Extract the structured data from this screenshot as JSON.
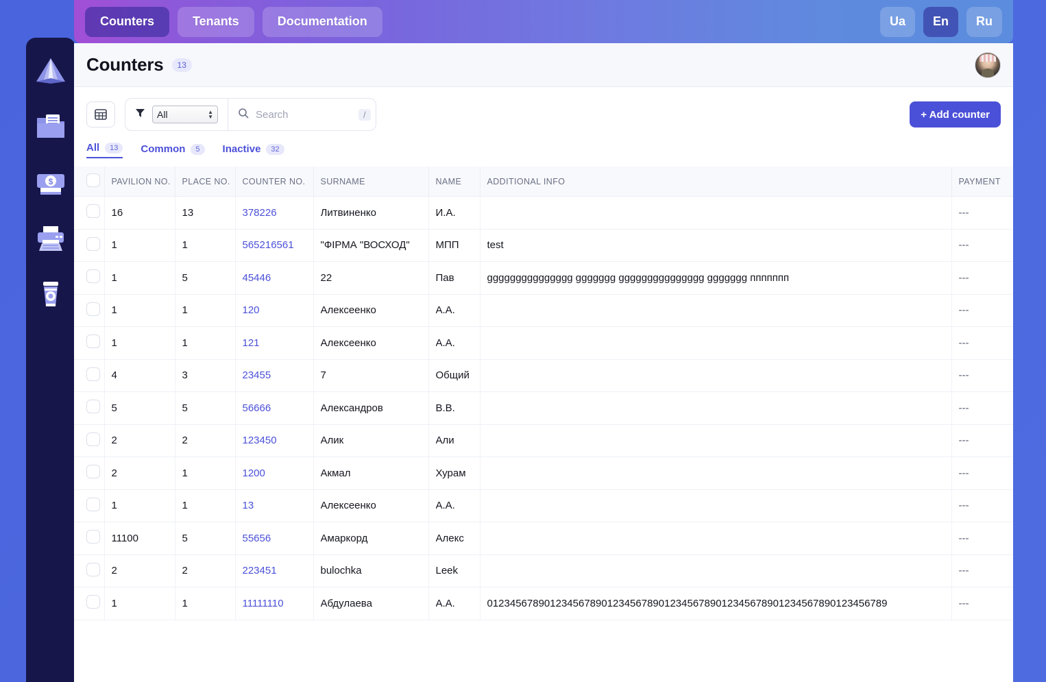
{
  "topnav": {
    "items": [
      {
        "label": "Counters",
        "active": true
      },
      {
        "label": "Tenants",
        "active": false
      },
      {
        "label": "Documentation",
        "active": false
      }
    ],
    "languages": [
      {
        "label": "Ua",
        "active": false
      },
      {
        "label": "En",
        "active": true
      },
      {
        "label": "Ru",
        "active": false
      }
    ]
  },
  "sidebar": {
    "items": [
      {
        "icon": "pyramid-logo-icon",
        "name": "logo"
      },
      {
        "icon": "folder-document-icon",
        "name": "documents"
      },
      {
        "icon": "money-cash-icon",
        "name": "payments"
      },
      {
        "icon": "printer-icon",
        "name": "print"
      },
      {
        "icon": "coffee-cup-icon",
        "name": "cafe"
      }
    ]
  },
  "header": {
    "title": "Counters",
    "count": "13"
  },
  "toolbar": {
    "grid_icon": "table-grid-icon",
    "filter_icon": "funnel-filter-icon",
    "filter_value": "All",
    "filter_options": [
      "All"
    ],
    "search_icon": "search-icon",
    "search_value": "",
    "search_placeholder": "Search",
    "search_shortcut": "/",
    "add_label": "+ Add counter"
  },
  "tabs": [
    {
      "label": "All",
      "count": "13",
      "active": true
    },
    {
      "label": "Common",
      "count": "5",
      "active": false
    },
    {
      "label": "Inactive",
      "count": "32",
      "active": false
    }
  ],
  "table": {
    "columns": [
      "PAVILION NO.",
      "PLACE NO.",
      "COUNTER NO.",
      "SURNAME",
      "NAME",
      "ADDITIONAL INFO",
      "PAYMENT"
    ],
    "rows": [
      {
        "pavilion": "16",
        "place": "13",
        "counter": "378226",
        "surname": "Литвиненко",
        "name": "И.А.",
        "info": "",
        "payment": "---"
      },
      {
        "pavilion": "1",
        "place": "1",
        "counter": "565216561",
        "surname": "\"ФІРМА \"ВОСХОД\"",
        "name": "МПП",
        "info": "test",
        "payment": "---"
      },
      {
        "pavilion": "1",
        "place": "5",
        "counter": "45446",
        "surname": "22",
        "name": "Пав",
        "info": "ggggggggggggggg ggggggg ggggggggggggggg ggggggg ппппппп",
        "payment": "---"
      },
      {
        "pavilion": "1",
        "place": "1",
        "counter": "120",
        "surname": "Алексеенко",
        "name": "А.А.",
        "info": "",
        "payment": "---"
      },
      {
        "pavilion": "1",
        "place": "1",
        "counter": "121",
        "surname": "Алексеенко",
        "name": "А.А.",
        "info": "",
        "payment": "---"
      },
      {
        "pavilion": "4",
        "place": "3",
        "counter": "23455",
        "surname": "7",
        "name": "Общий",
        "info": "",
        "payment": "---"
      },
      {
        "pavilion": "5",
        "place": "5",
        "counter": "56666",
        "surname": "Александров",
        "name": "В.В.",
        "info": "",
        "payment": "---"
      },
      {
        "pavilion": "2",
        "place": "2",
        "counter": "123450",
        "surname": "Алик",
        "name": "Али",
        "info": "",
        "payment": "---"
      },
      {
        "pavilion": "2",
        "place": "1",
        "counter": "1200",
        "surname": "Акмал",
        "name": "Хурам",
        "info": "",
        "payment": "---"
      },
      {
        "pavilion": "1",
        "place": "1",
        "counter": "13",
        "surname": "Алексеенко",
        "name": "А.А.",
        "info": "",
        "payment": "---"
      },
      {
        "pavilion": "11100",
        "place": "5",
        "counter": "55656",
        "surname": "Амаркорд",
        "name": "Алекс",
        "info": "",
        "payment": "---"
      },
      {
        "pavilion": "2",
        "place": "2",
        "counter": "223451",
        "surname": "bulochka",
        "name": "Leek",
        "info": "",
        "payment": "---"
      },
      {
        "pavilion": "1",
        "place": "1",
        "counter": "11111110",
        "surname": "Абдулаева",
        "name": "А.А.",
        "info": "0123456789012345678901234567890123456789012345678901234567890123456789",
        "payment": "---"
      }
    ]
  },
  "colors": {
    "accent": "#4b50d8",
    "sidebar_bg": "#17164b",
    "page_bg": "#4c6ade",
    "link": "#4b50d8"
  }
}
